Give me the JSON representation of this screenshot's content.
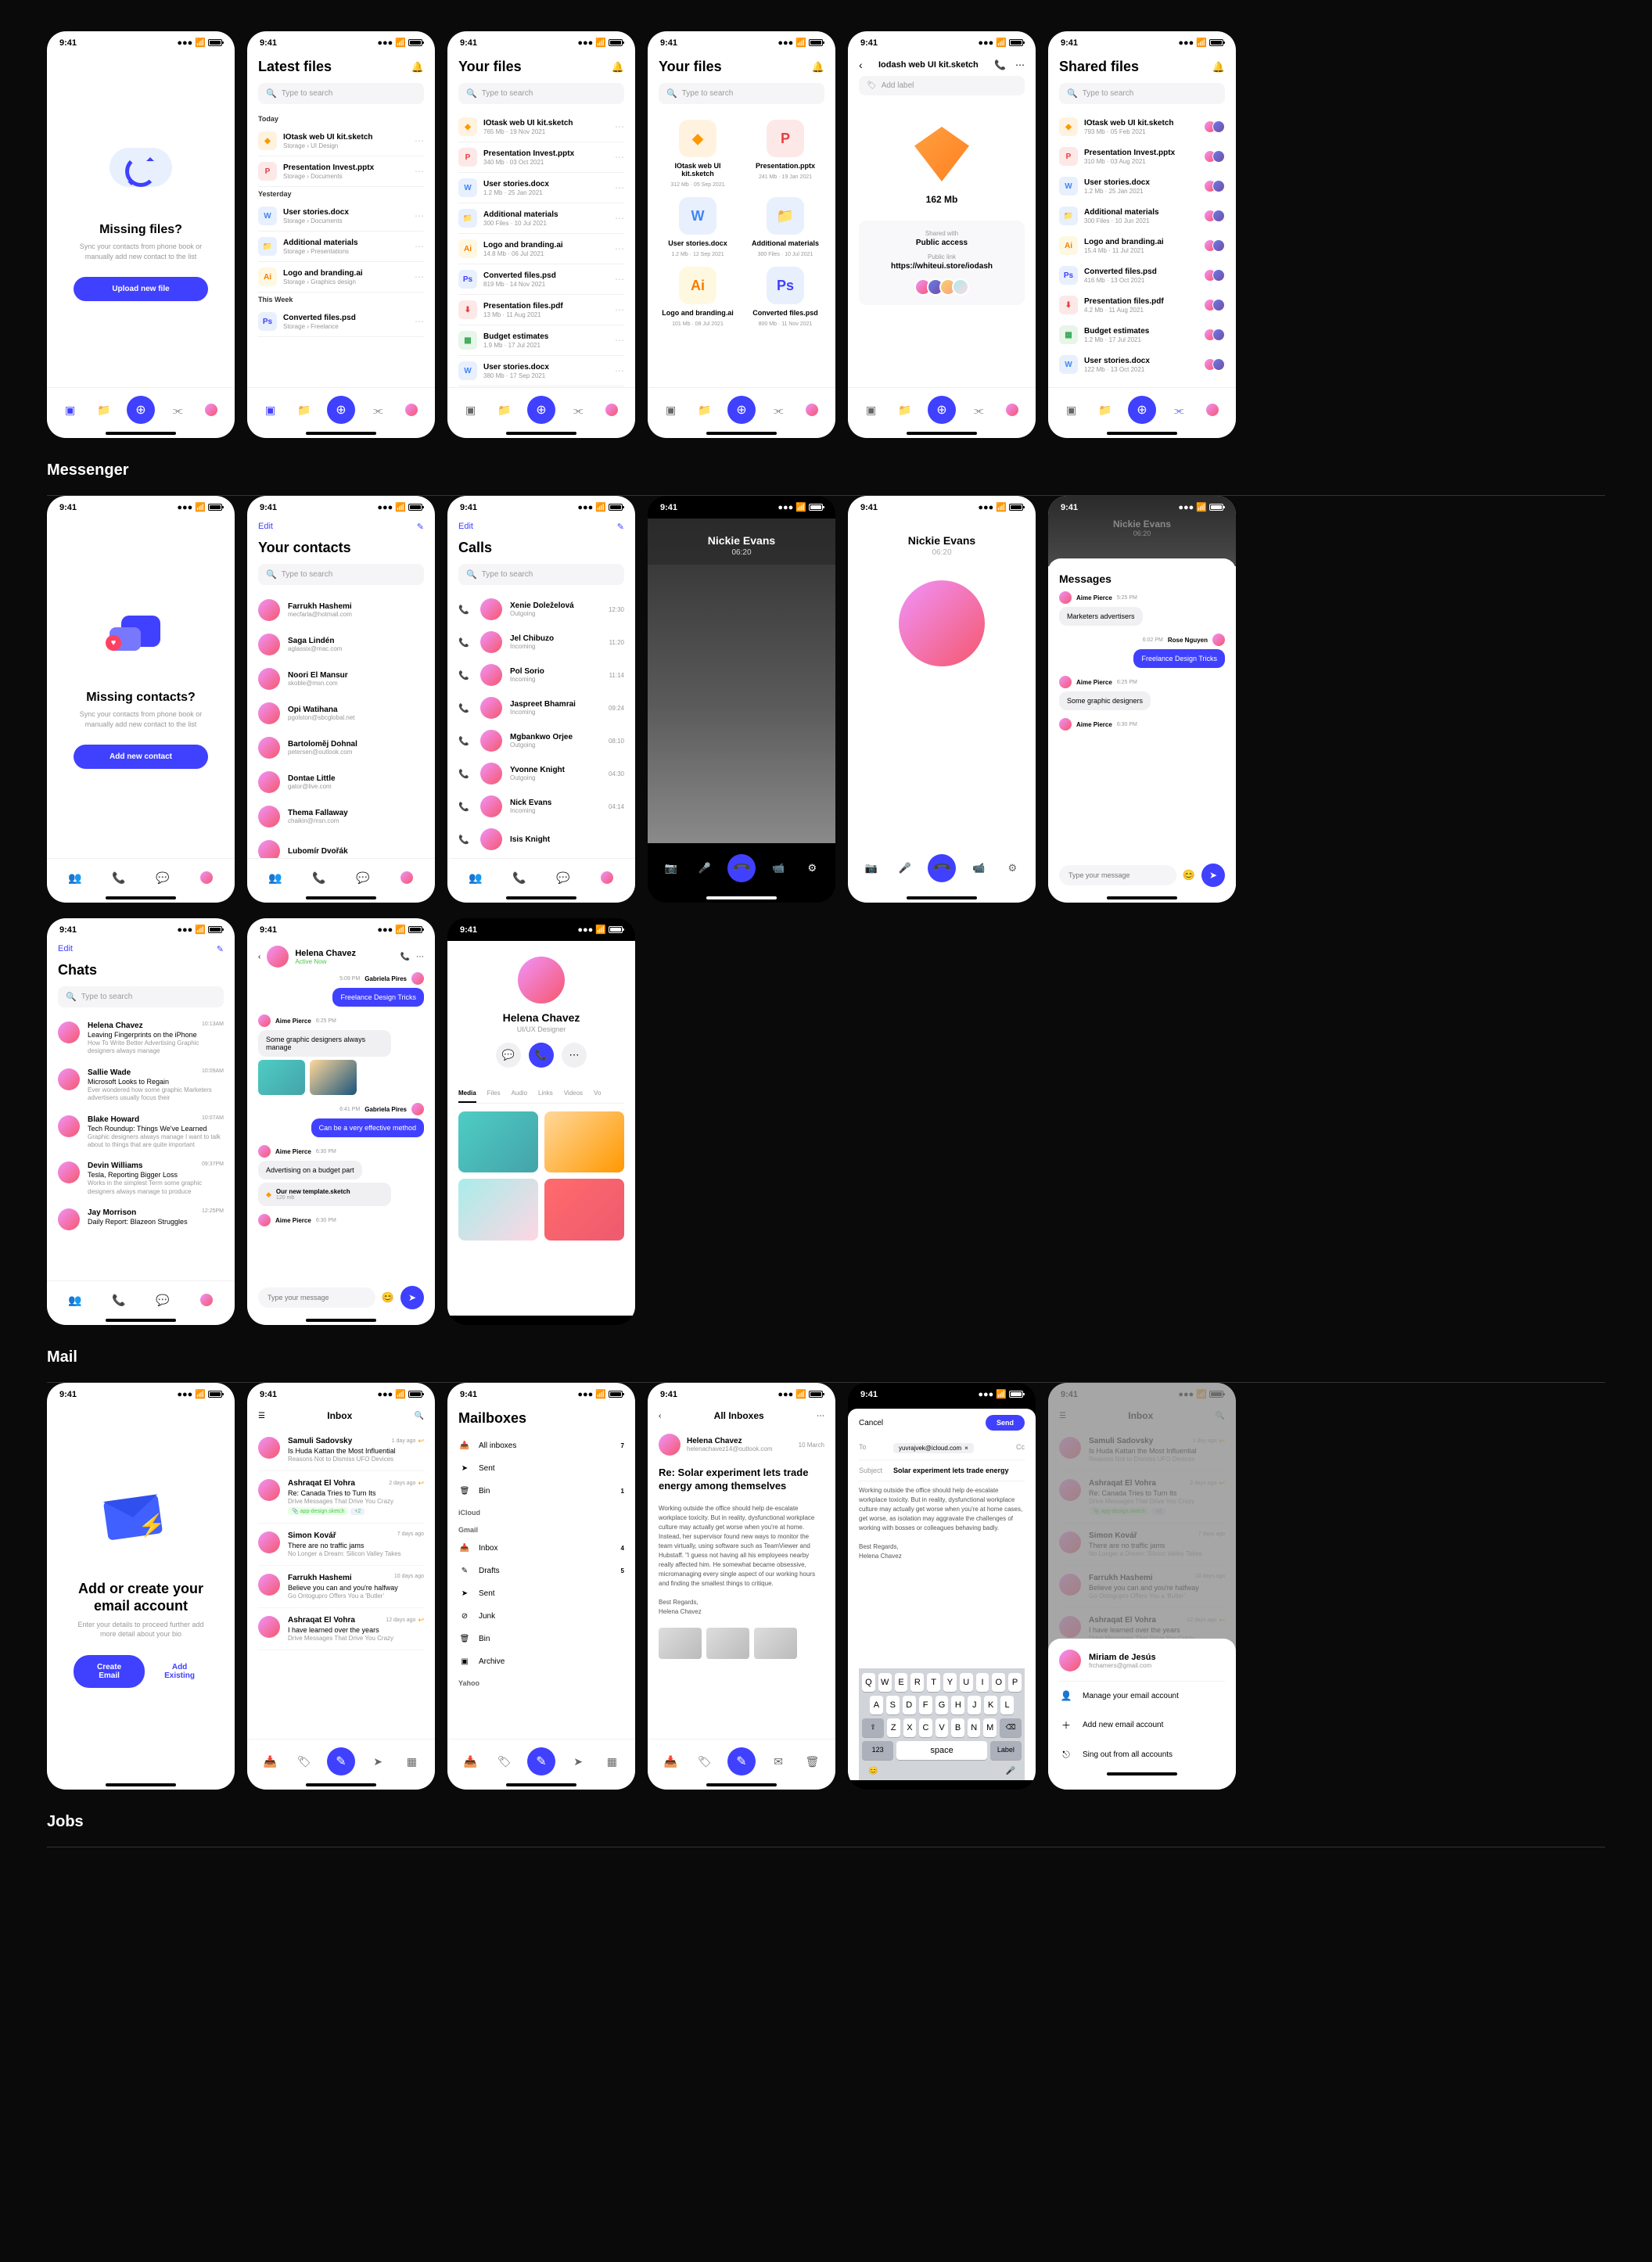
{
  "status_time": "9:41",
  "files": {
    "empty": {
      "title": "Missing files?",
      "sub": "Sync your contacts from phone book or manually add new contact to the list",
      "btn": "Upload new file"
    },
    "latest": {
      "title": "Latest files",
      "search": "Type to search",
      "sections": [
        {
          "label": "Today",
          "items": [
            {
              "icon": "sketch",
              "ext": "◆",
              "name": "IOtask web UI kit.sketch",
              "meta": "Storage  ›  UI Design"
            },
            {
              "icon": "pptx",
              "ext": "P",
              "name": "Presentation Invest.pptx",
              "meta": "Storage  ›  Documents"
            }
          ]
        },
        {
          "label": "Yesterday",
          "items": [
            {
              "icon": "docx",
              "ext": "W",
              "name": "User stories.docx",
              "meta": "Storage  ›  Documents"
            },
            {
              "icon": "folder",
              "ext": "📁",
              "name": "Additional materials",
              "meta": "Storage  ›  Presentations"
            },
            {
              "icon": "ai",
              "ext": "Ai",
              "name": "Logo and branding.ai",
              "meta": "Storage  ›  Graphics design"
            }
          ]
        },
        {
          "label": "This Week",
          "items": [
            {
              "icon": "psd",
              "ext": "Ps",
              "name": "Converted files.psd",
              "meta": "Storage  ›  Freelance"
            }
          ]
        }
      ]
    },
    "your": {
      "title": "Your files",
      "items": [
        {
          "icon": "sketch",
          "ext": "◆",
          "name": "IOtask web UI kit.sketch",
          "meta": "765 Mb  ·  19 Nov 2021"
        },
        {
          "icon": "pptx",
          "ext": "P",
          "name": "Presentation Invest.pptx",
          "meta": "340 Mb  ·  03 Oct 2021"
        },
        {
          "icon": "docx",
          "ext": "W",
          "name": "User stories.docx",
          "meta": "1.2 Mb  ·  25 Jan 2021"
        },
        {
          "icon": "folder",
          "ext": "📁",
          "name": "Additional materials",
          "meta": "300 Files  ·  10 Jul 2021"
        },
        {
          "icon": "ai",
          "ext": "Ai",
          "name": "Logo and branding.ai",
          "meta": "14.8 Mb  ·  06 Jul 2021"
        },
        {
          "icon": "psd",
          "ext": "Ps",
          "name": "Converted files.psd",
          "meta": "819 Mb  ·  14 Nov 2021"
        },
        {
          "icon": "pdf",
          "ext": "⬇",
          "name": "Presentation files.pdf",
          "meta": "13 Mb  ·  11 Aug 2021"
        },
        {
          "icon": "num",
          "ext": "▦",
          "name": "Budget estimates",
          "meta": "1.9 Mb  ·  17 Jul 2021"
        },
        {
          "icon": "docx",
          "ext": "W",
          "name": "User stories.docx",
          "meta": "380 Mb  ·  17 Sep 2021"
        }
      ]
    },
    "grid": {
      "title": "Your files",
      "items": [
        {
          "icon": "sketch",
          "ext": "◆",
          "name": "IOtask web UI kit.sketch",
          "meta": "312 Mb  ·  05 Sep 2021"
        },
        {
          "icon": "pptx",
          "ext": "P",
          "name": "Presentation.pptx",
          "meta": "241 Mb  ·  19 Jan 2021"
        },
        {
          "icon": "docx",
          "ext": "W",
          "name": "User stories.docx",
          "meta": "1.2 Mb  ·  12 Sep 2021"
        },
        {
          "icon": "folder",
          "ext": "📁",
          "name": "Additional materials",
          "meta": "300 Files  ·  10 Jul 2021"
        },
        {
          "icon": "ai",
          "ext": "Ai",
          "name": "Logo and branding.ai",
          "meta": "101 Mb  ·  08 Jul 2021"
        },
        {
          "icon": "psd",
          "ext": "Ps",
          "name": "Converted files.psd",
          "meta": "800 Mb  ·  11 Nov 2021"
        }
      ]
    },
    "detail": {
      "filename": "Iodash web UI kit.sketch",
      "label": "Add label",
      "size": "162 Mb",
      "shared_label": "Shared with",
      "access": "Public access",
      "link_label": "Public link",
      "link": "https://whiteui.store/iodash"
    },
    "shared": {
      "title": "Shared files",
      "items": [
        {
          "icon": "sketch",
          "ext": "◆",
          "name": "IOtask web UI kit.sketch",
          "meta": "793 Mb  ·  05 Feb 2021"
        },
        {
          "icon": "pptx",
          "ext": "P",
          "name": "Presentation Invest.pptx",
          "meta": "310 Mb  ·  03 Aug 2021"
        },
        {
          "icon": "docx",
          "ext": "W",
          "name": "User stories.docx",
          "meta": "1.2 Mb  ·  25 Jan 2021"
        },
        {
          "icon": "folder",
          "ext": "📁",
          "name": "Additional materials",
          "meta": "300 Files  ·  10 Jun 2021"
        },
        {
          "icon": "ai",
          "ext": "Ai",
          "name": "Logo and branding.ai",
          "meta": "15.4 Mb  ·  11 Jul 2021"
        },
        {
          "icon": "psd",
          "ext": "Ps",
          "name": "Converted files.psd",
          "meta": "416 Mb  ·  13 Oct 2021"
        },
        {
          "icon": "pdf",
          "ext": "⬇",
          "name": "Presentation files.pdf",
          "meta": "4.2 Mb  ·  11 Aug 2021"
        },
        {
          "icon": "num",
          "ext": "▦",
          "name": "Budget estimates",
          "meta": "1.2 Mb  ·  17 Jul 2021"
        },
        {
          "icon": "docx",
          "ext": "W",
          "name": "User stories.docx",
          "meta": "122 Mb  ·  13 Oct 2021"
        }
      ]
    }
  },
  "messenger": {
    "section": "Messenger",
    "empty": {
      "title": "Missing contacts?",
      "sub": "Sync your contacts from phone book or manually add new contact to the list",
      "btn": "Add new contact"
    },
    "contacts": {
      "edit": "Edit",
      "title": "Your contacts",
      "search": "Type to search",
      "items": [
        {
          "name": "Farrukh Hashemi",
          "email": "mecfarla@hotmail.com"
        },
        {
          "name": "Saga Lindén",
          "email": "aglassix@mac.com"
        },
        {
          "name": "Noori El Mansur",
          "email": "skoble@msn.com"
        },
        {
          "name": "Opi Watihana",
          "email": "pgolston@sbcglobal.net"
        },
        {
          "name": "Bartolomĕj Dohnal",
          "email": "petersen@outlook.com"
        },
        {
          "name": "Dontae Little",
          "email": "gator@live.com"
        },
        {
          "name": "Thema Fallaway",
          "email": "chaikin@msn.com"
        },
        {
          "name": "Lubomír Dvořák",
          "email": ""
        }
      ]
    },
    "calls": {
      "edit": "Edit",
      "title": "Calls",
      "search": "Type to search",
      "items": [
        {
          "name": "Xenie Doleželová",
          "type": "Outgoing",
          "time": "12:30"
        },
        {
          "name": "Jel Chibuzo",
          "type": "Incoming",
          "time": "11:20"
        },
        {
          "name": "Pol Sorio",
          "type": "Incoming",
          "time": "11:14"
        },
        {
          "name": "Jaspreet Bhamrai",
          "type": "Incoming",
          "time": "09:24"
        },
        {
          "name": "Mgbankwo Orjee",
          "type": "Outgoing",
          "time": "08:10"
        },
        {
          "name": "Yvonne Knight",
          "type": "Outgoing",
          "time": "04:30"
        },
        {
          "name": "Nick Evans",
          "type": "Incoming",
          "time": "04:14"
        },
        {
          "name": "Isis Knight",
          "type": "",
          "time": ""
        }
      ]
    },
    "active_call": {
      "name": "Nickie Evans",
      "time": "06:20"
    },
    "minimized": {
      "name": "Nickie Evans",
      "time": "06:20",
      "messages": "Messages",
      "m1_sender": "Aime Pierce",
      "m1_time": "5:25 PM",
      "m1_text": "Marketers advertisers",
      "m2_time": "6:02 PM",
      "m2_sender": "Rose Nguyen",
      "m2_text": "Freelance Design Tricks",
      "m3_sender": "Aime Pierce",
      "m3_time": "6:25 PM",
      "m3_text": "Some graphic designers",
      "m4_sender": "Aime Pierce",
      "m4_time": "6:30 PM",
      "input": "Type your message"
    },
    "chats": {
      "edit": "Edit",
      "title": "Chats",
      "search": "Type to search",
      "items": [
        {
          "name": "Helena Chavez",
          "time": "10:13AM",
          "subject": "Leaving Fingerprints on the iPhone",
          "preview": "How To Write Better Advertising Graphic designers always manage"
        },
        {
          "name": "Sallie Wade",
          "time": "10:09AM",
          "subject": "Microsoft Looks to Regain",
          "preview": "Ever wondered how some graphic Marketers advertisers usually focus their"
        },
        {
          "name": "Blake Howard",
          "time": "10:07AM",
          "subject": "Tech Roundup: Things We've Learned",
          "preview": "Graphic designers always manage I want to talk about to things that are quite important"
        },
        {
          "name": "Devin Williams",
          "time": "09:37PM",
          "subject": "Tesla, Reporting Bigger Loss",
          "preview": "Works in the simplest Term some graphic designers always manage to produce"
        },
        {
          "name": "Jay Morrison",
          "time": "12:25PM",
          "subject": "Daily Report: Blazeon Struggles",
          "preview": ""
        }
      ]
    },
    "conversation": {
      "name": "Helena Chavez",
      "status": "Active Now",
      "m1_time": "5:09 PM",
      "m1_sender": "Gabriela Pires",
      "m1_text": "Freelance Design Tricks",
      "m2_sender": "Aime Pierce",
      "m2_time": "6:25 PM",
      "m2_text": "Some graphic designers always manage",
      "m3_time": "6:41 PM",
      "m3_sender": "Gabriela Pires",
      "m3_text": "Can be a very effective method",
      "m4_sender": "Aime Pierce",
      "m4_time": "6:30 PM",
      "m4_text": "Advertising on a budget part",
      "m5_file": "Our new template.sketch",
      "m5_size": "120 mb",
      "m6_sender": "Aime Pierce",
      "m6_time": "6:30 PM",
      "input": "Type your message"
    },
    "profile": {
      "name": "Helena Chavez",
      "role": "UI/UX Designer",
      "tabs": [
        "Media",
        "Files",
        "Audio",
        "Links",
        "Videos",
        "Vo"
      ]
    }
  },
  "mail": {
    "section": "Mail",
    "empty": {
      "title": "Add or create your email account",
      "sub": "Enter your details to proceed further add more detail about your bio",
      "btn1": "Create Email",
      "btn2": "Add Existing"
    },
    "inbox": {
      "title": "Inbox",
      "items": [
        {
          "sender": "Samuli Sadovsky",
          "date": "1 day ago",
          "subject": "Is Huda Kattan the Most Influential",
          "preview": "Reasons Not to Dismiss UFO Devices",
          "reply": true
        },
        {
          "sender": "Ashraqat El Vohra",
          "date": "2 days ago",
          "subject": "Re: Canada Tries to Turn Its",
          "preview": "Drive Messages That Drive You Crazy",
          "reply": true,
          "tag": "app-design.sketch",
          "badge": "+2"
        },
        {
          "sender": "Simon Kovář",
          "date": "7 days ago",
          "subject": "There are no traffic jams",
          "preview": "No Longer a Dream: Silicon Valley Takes"
        },
        {
          "sender": "Farrukh Hashemi",
          "date": "10 days ago",
          "subject": "Believe you can and you're halfway",
          "preview": "Go Ontogupro Offers You a 'Butler'"
        },
        {
          "sender": "Ashraqat El Vohra",
          "date": "12 days ago",
          "subject": "I have learned over the years",
          "preview": "Drive Messages That Drive You Crazy",
          "reply": true
        }
      ]
    },
    "mailboxes": {
      "title": "Mailboxes",
      "top": [
        {
          "icon": "📥",
          "name": "All inboxes",
          "count": "7"
        },
        {
          "icon": "➤",
          "name": "Sent",
          "count": ""
        },
        {
          "icon": "🗑",
          "name": "Bin",
          "count": "1"
        }
      ],
      "icloud": "iCloud",
      "gmail": "Gmail",
      "gmail_items": [
        {
          "icon": "📥",
          "name": "Inbox",
          "count": "4"
        },
        {
          "icon": "✎",
          "name": "Drafts",
          "count": "5"
        },
        {
          "icon": "➤",
          "name": "Sent",
          "count": ""
        },
        {
          "icon": "⊘",
          "name": "Junk",
          "count": ""
        },
        {
          "icon": "🗑",
          "name": "Bin",
          "count": ""
        },
        {
          "icon": "▣",
          "name": "Archive",
          "count": ""
        }
      ],
      "yahoo": "Yahoo"
    },
    "detail": {
      "title": "All Inboxes",
      "sender": "Helena Chavez",
      "email": "helenachavez14@outlook.com",
      "date": "10 March",
      "subject": "Re: Solar experiment lets trade energy among themselves",
      "body": "Working outside the office should help de-escalate workplace toxicity. But in reality, dysfunctional workplace culture may actually get worse when you're at home. Instead, her supervisor found new ways to monitor the team virtually, using software such as TeamViewer and Hubstaff. \"I guess not having all his employees nearby really affected him. He somewhat became obsessive, micromanaging every single aspect of our working hours and finding the smallest things to critique.",
      "sign1": "Best Regards,",
      "sign2": "Helena Chavez"
    },
    "compose": {
      "cancel": "Cancel",
      "send": "Send",
      "to": "To",
      "to_val": "yuvrajvek@icloud.com",
      "cc": "Cc",
      "subj_label": "Subject",
      "subject": "Solar experiment lets trade energy",
      "body": "Working outside the office should help de-escalate workplace toxicity. But in reality, dysfunctional workplace culture may actually get worse when you're at home cases, get worse, as isolation may aggravate the challenges of working with bosses or colleagues behaving badly.",
      "sign1": "Best Regards,",
      "sign2": "Helena Chavez",
      "keys_r1": [
        "Q",
        "W",
        "E",
        "R",
        "T",
        "Y",
        "U",
        "I",
        "O",
        "P"
      ],
      "keys_r2": [
        "A",
        "S",
        "D",
        "F",
        "G",
        "H",
        "J",
        "K",
        "L"
      ],
      "keys_r3": [
        "Z",
        "X",
        "C",
        "V",
        "B",
        "N",
        "M"
      ],
      "shift": "⇧",
      "del": "⌫",
      "num": "123",
      "space": "space",
      "label": "Label"
    },
    "sheet": {
      "name": "Miriam de Jesús",
      "email": "frchamers@gmail.com",
      "items": [
        {
          "icon": "👤",
          "label": "Manage your email account"
        },
        {
          "icon": "＋",
          "label": "Add new email account"
        },
        {
          "icon": "⎋",
          "label": "Sing out from all accounts"
        }
      ]
    }
  },
  "jobs": {
    "section": "Jobs"
  }
}
